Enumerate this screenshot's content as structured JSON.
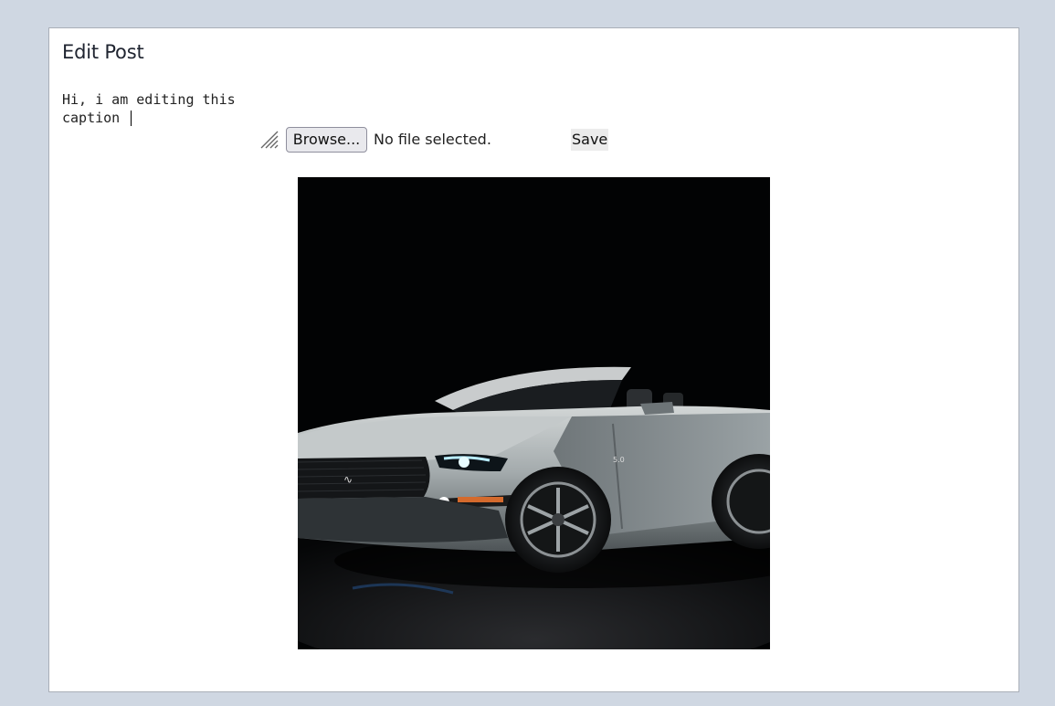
{
  "page": {
    "title": "Edit Post"
  },
  "form": {
    "caption_value": "Hi, i am editing this caption",
    "browse_label": "Browse...",
    "file_status": "No file selected.",
    "save_label": "Save"
  },
  "image": {
    "alt": "Silver convertible sports car photographed against a black background"
  },
  "colors": {
    "page_background": "#cfd7e2",
    "card_background": "#ffffff",
    "card_border": "#a9afb8"
  }
}
